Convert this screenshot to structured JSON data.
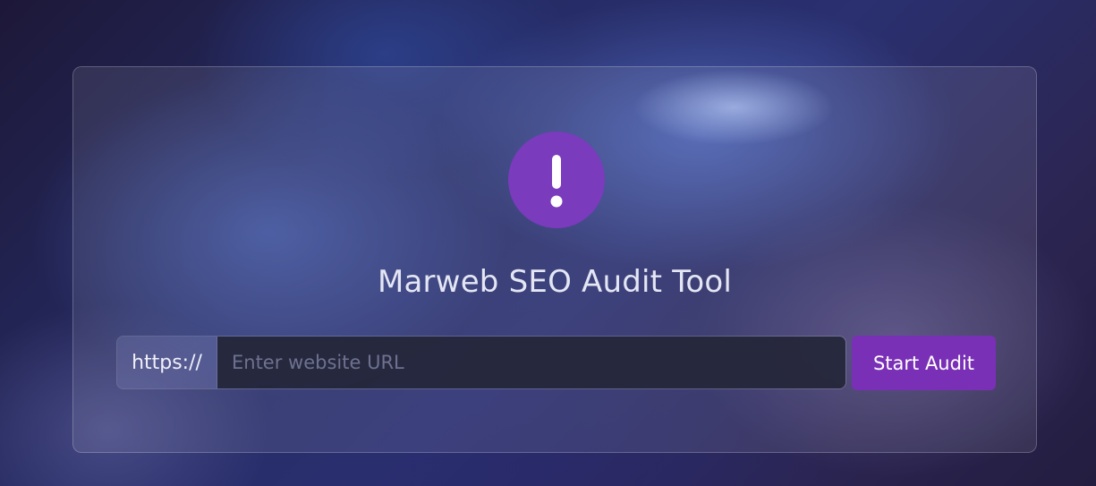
{
  "app": {
    "title": "Marweb SEO Audit Tool"
  },
  "icon": {
    "name": "alert-circle-icon",
    "color": "#7a3bbd",
    "glyph": "!"
  },
  "form": {
    "prefix": "https://",
    "placeholder": "Enter website URL",
    "value": "",
    "submit_label": "Start Audit",
    "submit_color": "#7a30b6"
  }
}
